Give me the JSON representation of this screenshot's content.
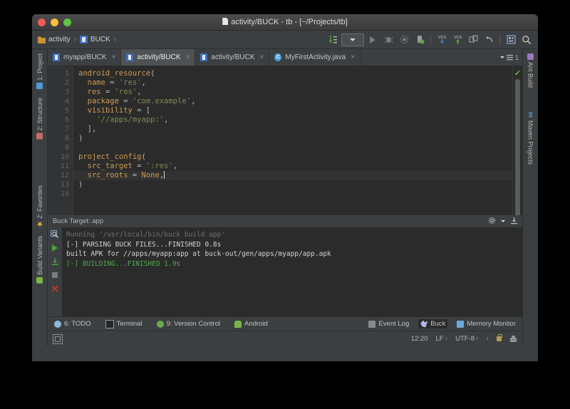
{
  "window": {
    "title": "activity/BUCK - tb - [~/Projects/tb]",
    "traffic_lights": [
      "close",
      "minimize",
      "maximize"
    ]
  },
  "breadcrumb": {
    "items": [
      {
        "label": "activity",
        "icon": "folder-icon"
      },
      {
        "label": "BUCK",
        "icon": "buck-file-icon"
      }
    ],
    "separator": "›"
  },
  "toolbar": {
    "buttons": [
      {
        "name": "sync-project-icon",
        "title": "Sync Project"
      },
      {
        "name": "run-config-dropdown",
        "title": "Run Configurations"
      },
      {
        "name": "run-icon",
        "title": "Run"
      },
      {
        "name": "debug-icon",
        "title": "Debug"
      },
      {
        "name": "coverage-icon",
        "title": "Run with Coverage"
      },
      {
        "name": "profile-icon",
        "title": "Profile"
      },
      {
        "name": "vcs-update-icon",
        "title": "Update Project",
        "label": "VCS"
      },
      {
        "name": "vcs-commit-icon",
        "title": "Commit",
        "label": "VCS"
      },
      {
        "name": "vcs-diff-icon",
        "title": "Compare with Latest"
      },
      {
        "name": "undo-icon",
        "title": "Undo"
      },
      {
        "name": "layout-icon",
        "title": "Layout"
      },
      {
        "name": "search-icon",
        "title": "Search Everywhere"
      }
    ]
  },
  "editor_tabs": {
    "items": [
      {
        "label": "myapp/BUCK",
        "icon": "buck-file-icon",
        "active": false
      },
      {
        "label": "activity/BUCK",
        "icon": "buck-file-icon",
        "active": true
      },
      {
        "label": "activity/BUCK",
        "icon": "buck-file-icon",
        "active": false
      },
      {
        "label": "MyFirstActivity.java",
        "icon": "java-class-icon",
        "active": false
      }
    ],
    "close_glyph": "×",
    "menu_count": "1"
  },
  "editor": {
    "line_numbers": [
      "1",
      "2",
      "3",
      "4",
      "5",
      "6",
      "7",
      "8",
      "9",
      "10",
      "11",
      "12",
      "13",
      "14"
    ],
    "lines": [
      {
        "num": 1,
        "current": false,
        "tokens": [
          {
            "t": "kw",
            "s": "android_resource"
          },
          {
            "t": "op",
            "s": "("
          }
        ]
      },
      {
        "num": 2,
        "current": false,
        "tokens": [
          {
            "t": "pl",
            "s": "  "
          },
          {
            "t": "kw",
            "s": "name"
          },
          {
            "t": "op",
            "s": " = "
          },
          {
            "t": "str",
            "s": "'res'"
          },
          {
            "t": "op",
            "s": ","
          }
        ]
      },
      {
        "num": 3,
        "current": false,
        "tokens": [
          {
            "t": "pl",
            "s": "  "
          },
          {
            "t": "kw",
            "s": "res"
          },
          {
            "t": "op",
            "s": " = "
          },
          {
            "t": "str",
            "s": "'res'"
          },
          {
            "t": "op",
            "s": ","
          }
        ]
      },
      {
        "num": 4,
        "current": false,
        "tokens": [
          {
            "t": "pl",
            "s": "  "
          },
          {
            "t": "kw",
            "s": "package"
          },
          {
            "t": "op",
            "s": " = "
          },
          {
            "t": "str",
            "s": "'com.example'"
          },
          {
            "t": "op",
            "s": ","
          }
        ]
      },
      {
        "num": 5,
        "current": false,
        "tokens": [
          {
            "t": "pl",
            "s": "  "
          },
          {
            "t": "kw",
            "s": "visibility"
          },
          {
            "t": "op",
            "s": " = ["
          }
        ]
      },
      {
        "num": 6,
        "current": false,
        "tokens": [
          {
            "t": "pl",
            "s": "    "
          },
          {
            "t": "str",
            "s": "'//apps/myapp:'"
          },
          {
            "t": "op",
            "s": ","
          }
        ]
      },
      {
        "num": 7,
        "current": false,
        "tokens": [
          {
            "t": "pl",
            "s": "  "
          },
          {
            "t": "op",
            "s": "],"
          }
        ]
      },
      {
        "num": 8,
        "current": false,
        "tokens": [
          {
            "t": "op",
            "s": ")"
          }
        ]
      },
      {
        "num": 9,
        "current": false,
        "tokens": [
          {
            "t": "pl",
            "s": ""
          }
        ]
      },
      {
        "num": 10,
        "current": false,
        "tokens": [
          {
            "t": "kw",
            "s": "project_config"
          },
          {
            "t": "op",
            "s": "("
          }
        ]
      },
      {
        "num": 11,
        "current": false,
        "tokens": [
          {
            "t": "pl",
            "s": "  "
          },
          {
            "t": "kw",
            "s": "src_target"
          },
          {
            "t": "op",
            "s": " = "
          },
          {
            "t": "str",
            "s": "':res'"
          },
          {
            "t": "op",
            "s": ","
          }
        ]
      },
      {
        "num": 12,
        "current": true,
        "tokens": [
          {
            "t": "pl",
            "s": "  "
          },
          {
            "t": "kw",
            "s": "src_roots"
          },
          {
            "t": "op",
            "s": " = "
          },
          {
            "t": "kw",
            "s": "None"
          },
          {
            "t": "op",
            "s": ","
          }
        ],
        "caret": true
      },
      {
        "num": 13,
        "current": false,
        "tokens": [
          {
            "t": "op",
            "s": ")"
          }
        ]
      },
      {
        "num": 14,
        "current": false,
        "tokens": [
          {
            "t": "pl",
            "s": ""
          }
        ]
      }
    ],
    "inspection_status": "✓"
  },
  "left_tool_strip": {
    "items": [
      {
        "label": "1: Project",
        "icon": "project-icon"
      },
      {
        "label": "2: Structure",
        "icon": "structure-icon"
      },
      {
        "label": "2: Favorites",
        "icon": "favorites-star-icon"
      },
      {
        "label": "Build Variants",
        "icon": "android-icon"
      }
    ]
  },
  "right_tool_strip": {
    "items": [
      {
        "label": "Ant Build",
        "icon": "ant-icon"
      },
      {
        "label": "Maven Projects",
        "icon": "maven-icon"
      }
    ]
  },
  "console": {
    "header": "Buck Target: app",
    "tools": [
      {
        "name": "settings-gear-icon"
      },
      {
        "name": "collapse-icon"
      }
    ],
    "side_buttons": [
      {
        "name": "console-search-icon"
      },
      {
        "name": "console-rerun-icon"
      },
      {
        "name": "console-export-icon"
      },
      {
        "name": "console-stop-icon"
      },
      {
        "name": "console-close-icon"
      }
    ],
    "output": [
      {
        "text": "Running '/usr/local/bin/buck build app'",
        "style": "c-dim"
      },
      {
        "text": "[-] PARSING BUCK FILES...FINISHED 0.8s",
        "style": "c-norm"
      },
      {
        "text": "built APK for //apps/myapp:app at buck-out/gen/apps/myapp/app.apk",
        "style": "c-norm"
      },
      {
        "text": "[-] BUILDING...FINISHED 1.9s",
        "style": "c-green"
      }
    ]
  },
  "tool_window_bar": {
    "left": [
      {
        "label": "6: TODO",
        "mnemonic": "6",
        "icon": "todo-icon",
        "active": false
      },
      {
        "label": "Terminal",
        "mnemonic": "",
        "icon": "terminal-icon",
        "active": false
      },
      {
        "label": "9: Version Control",
        "mnemonic": "9",
        "icon": "version-control-icon",
        "active": false
      },
      {
        "label": "Android",
        "mnemonic": "",
        "icon": "android-icon",
        "active": false
      }
    ],
    "right": [
      {
        "label": "Event Log",
        "icon": "event-log-icon",
        "active": false
      },
      {
        "label": "Buck",
        "icon": "buck-icon",
        "active": true
      },
      {
        "label": "Memory Monitor",
        "icon": "memory-monitor-icon",
        "active": false
      }
    ]
  },
  "status_bar": {
    "left_icon": "toggle-toolwindows-icon",
    "items": [
      {
        "name": "caret-position",
        "label": "12:20"
      },
      {
        "name": "line-separator",
        "label": "LF",
        "arrows": "↕"
      },
      {
        "name": "file-encoding",
        "label": "UTF-8",
        "arrows": "↕"
      },
      {
        "name": "indent-selector",
        "label": "",
        "arrows": "↕"
      },
      {
        "name": "read-only-lock-icon",
        "label": ""
      },
      {
        "name": "hector-icon",
        "label": ""
      }
    ]
  },
  "colors": {
    "chrome": "#3c3f41",
    "editor_bg": "#2b2b2b",
    "keyword": "#cc9955",
    "string": "#7f8a5a",
    "plain": "#a9b7c6",
    "success_green": "#4fa84f",
    "accent_blue": "#4f9ad6"
  }
}
